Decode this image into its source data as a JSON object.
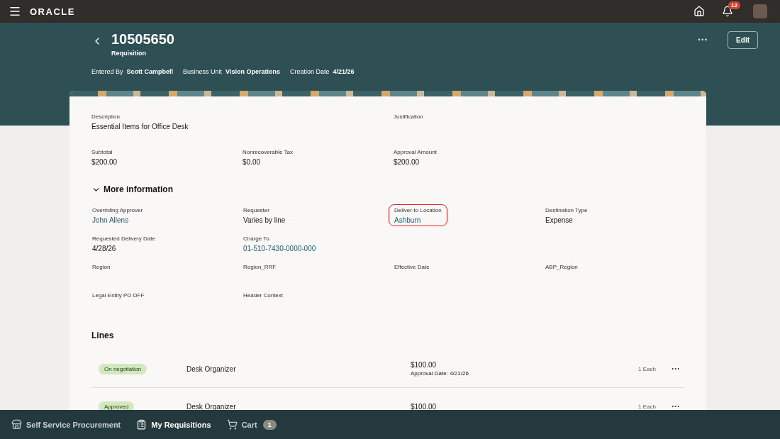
{
  "top_bar": {
    "brand": "ORACLE",
    "notification_count": "12"
  },
  "header": {
    "title": "10505650",
    "subtitle": "Requisition",
    "actions": {
      "more": "···",
      "edit": "Edit"
    },
    "meta": [
      {
        "label": "Entered By",
        "value": "Scott Campbell"
      },
      {
        "label": "Business Unit",
        "value": "Vision Operations"
      },
      {
        "label": "Creation Date",
        "value": "4/21/26"
      }
    ]
  },
  "summary_rows": [
    [
      {
        "label": "Description",
        "value": "Essential Items for Office Desk",
        "kind": "text"
      },
      {
        "label": "Justification"
      }
    ],
    [
      {
        "label": "Subtotal",
        "value": "$200.00",
        "kind": "text"
      },
      {
        "label": "Nonrecoverable Tax",
        "value": "$0.00",
        "kind": "text"
      },
      {
        "label": "Approval Amount",
        "value": "$200.00",
        "kind": "text"
      }
    ]
  ],
  "more_information": {
    "title": "More information",
    "expanded": true,
    "rows": [
      [
        {
          "label": "Overriding Approver",
          "value": "John Allens",
          "kind": "link",
          "highlighted": false
        },
        {
          "label": "Requester",
          "value": "Varies by line",
          "kind": "text",
          "highlighted": false
        },
        {
          "label": "Deliver-to Location",
          "value": "Ashburn",
          "kind": "link",
          "highlighted": true
        },
        {
          "label": "Destination Type",
          "value": "Expense",
          "kind": "text",
          "highlighted": false
        }
      ],
      [
        {
          "label": "Requested Delivery Date",
          "value": "4/28/26",
          "kind": "text",
          "highlighted": false
        },
        {
          "label": "Charge To",
          "value": "01-510-7430-0000-000",
          "kind": "link",
          "highlighted": false
        }
      ],
      [
        {
          "label": "Region",
          "highlighted": false
        },
        {
          "label": "Region_RRF",
          "highlighted": false
        },
        {
          "label": "Effective Date",
          "highlighted": false
        },
        {
          "label": "ABP_Region",
          "highlighted": false
        }
      ],
      [
        {
          "label": "Legal Entity PO DFF",
          "highlighted": false
        },
        {
          "label": "Header Context",
          "highlighted": false
        }
      ]
    ]
  },
  "lines": {
    "title": "Lines",
    "rows": [
      {
        "status": "On negotiation",
        "item": "Desk Organizer",
        "amount": "$100.00",
        "approval_date": "Approval Date: 4/21/26",
        "quantity": "1 Each",
        "more": "···"
      },
      {
        "status": "Approved",
        "item": "Desk Organizer",
        "amount": "$100.00",
        "quantity": "1 Each",
        "more": "···"
      }
    ]
  },
  "bottom_nav": [
    {
      "label": "Self Service Procurement",
      "selected": false
    },
    {
      "label": "My Requisitions",
      "selected": true
    },
    {
      "label": "Cart",
      "selected": false,
      "badge": "1"
    }
  ]
}
